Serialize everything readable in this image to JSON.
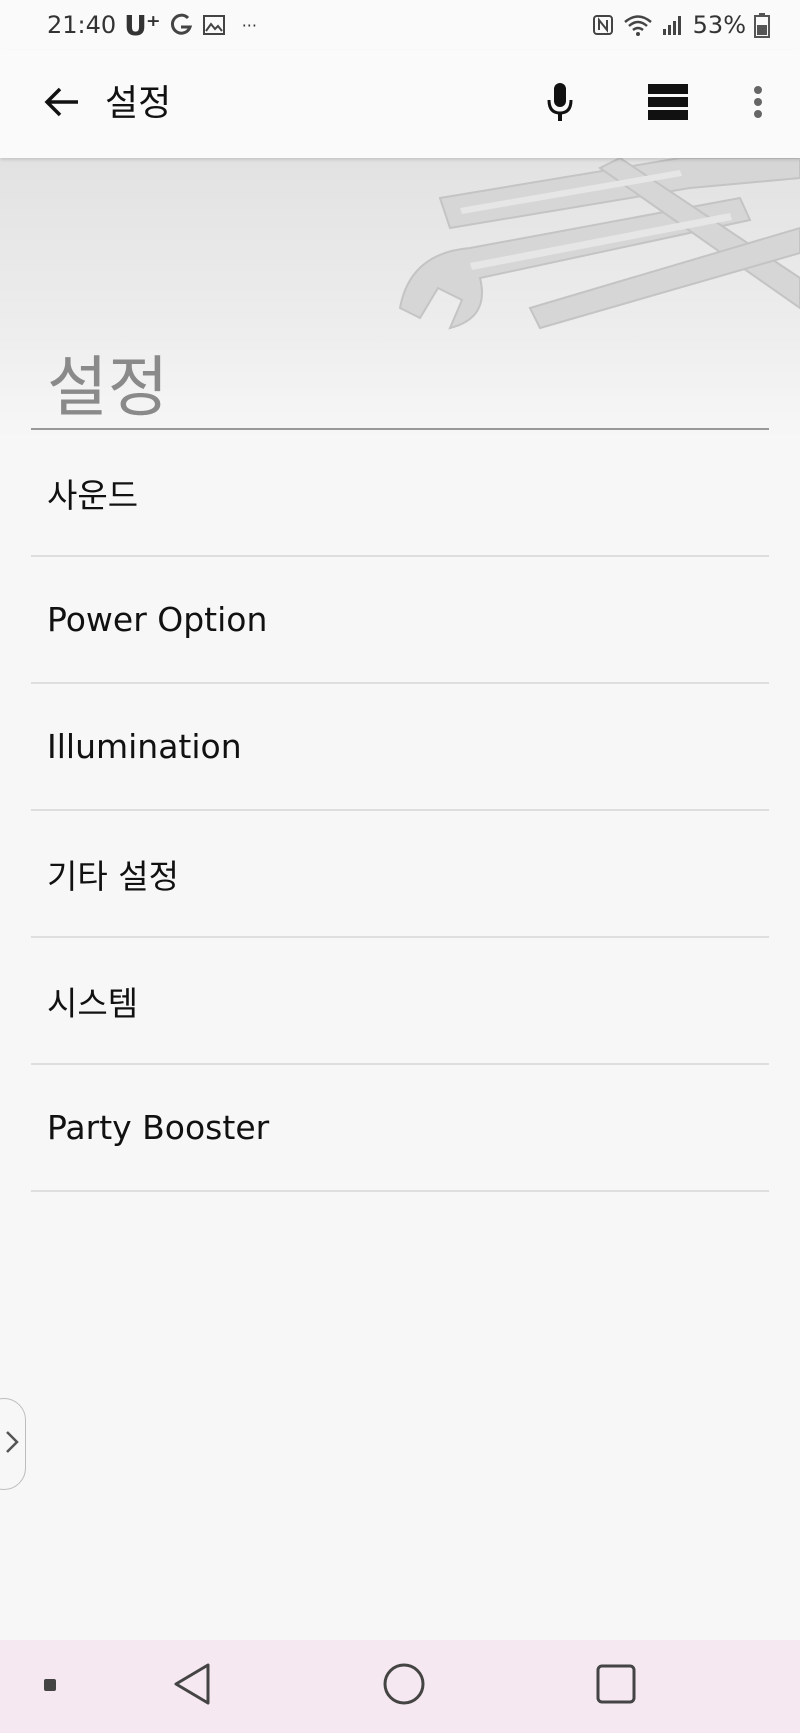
{
  "status_bar": {
    "time": "21:40",
    "carrier": "U⁺",
    "notification_dots": "···",
    "battery_percent": "53%",
    "icons": [
      "carrier-g-icon",
      "image-icon",
      "nfc-icon",
      "wifi-icon",
      "signal-icon",
      "battery-icon"
    ]
  },
  "app_bar": {
    "title": "설정",
    "icons": [
      "back-arrow-icon",
      "microphone-icon",
      "list-view-icon",
      "more-vert-icon"
    ]
  },
  "section": {
    "title": "설정"
  },
  "menu": {
    "items": [
      {
        "label": "사운드"
      },
      {
        "label": "Power Option"
      },
      {
        "label": "Illumination"
      },
      {
        "label": "기타 설정"
      },
      {
        "label": "시스템"
      },
      {
        "label": "Party Booster"
      }
    ]
  },
  "nav_bar": {
    "icons": [
      "dot-icon",
      "back-triangle-icon",
      "home-circle-icon",
      "recents-square-icon"
    ]
  },
  "colors": {
    "background": "#f7f7f7",
    "app_bar": "#fafafa",
    "nav_bar": "#f5e8f1",
    "divider": "#dedede",
    "section_title": "#8a8a8a"
  }
}
